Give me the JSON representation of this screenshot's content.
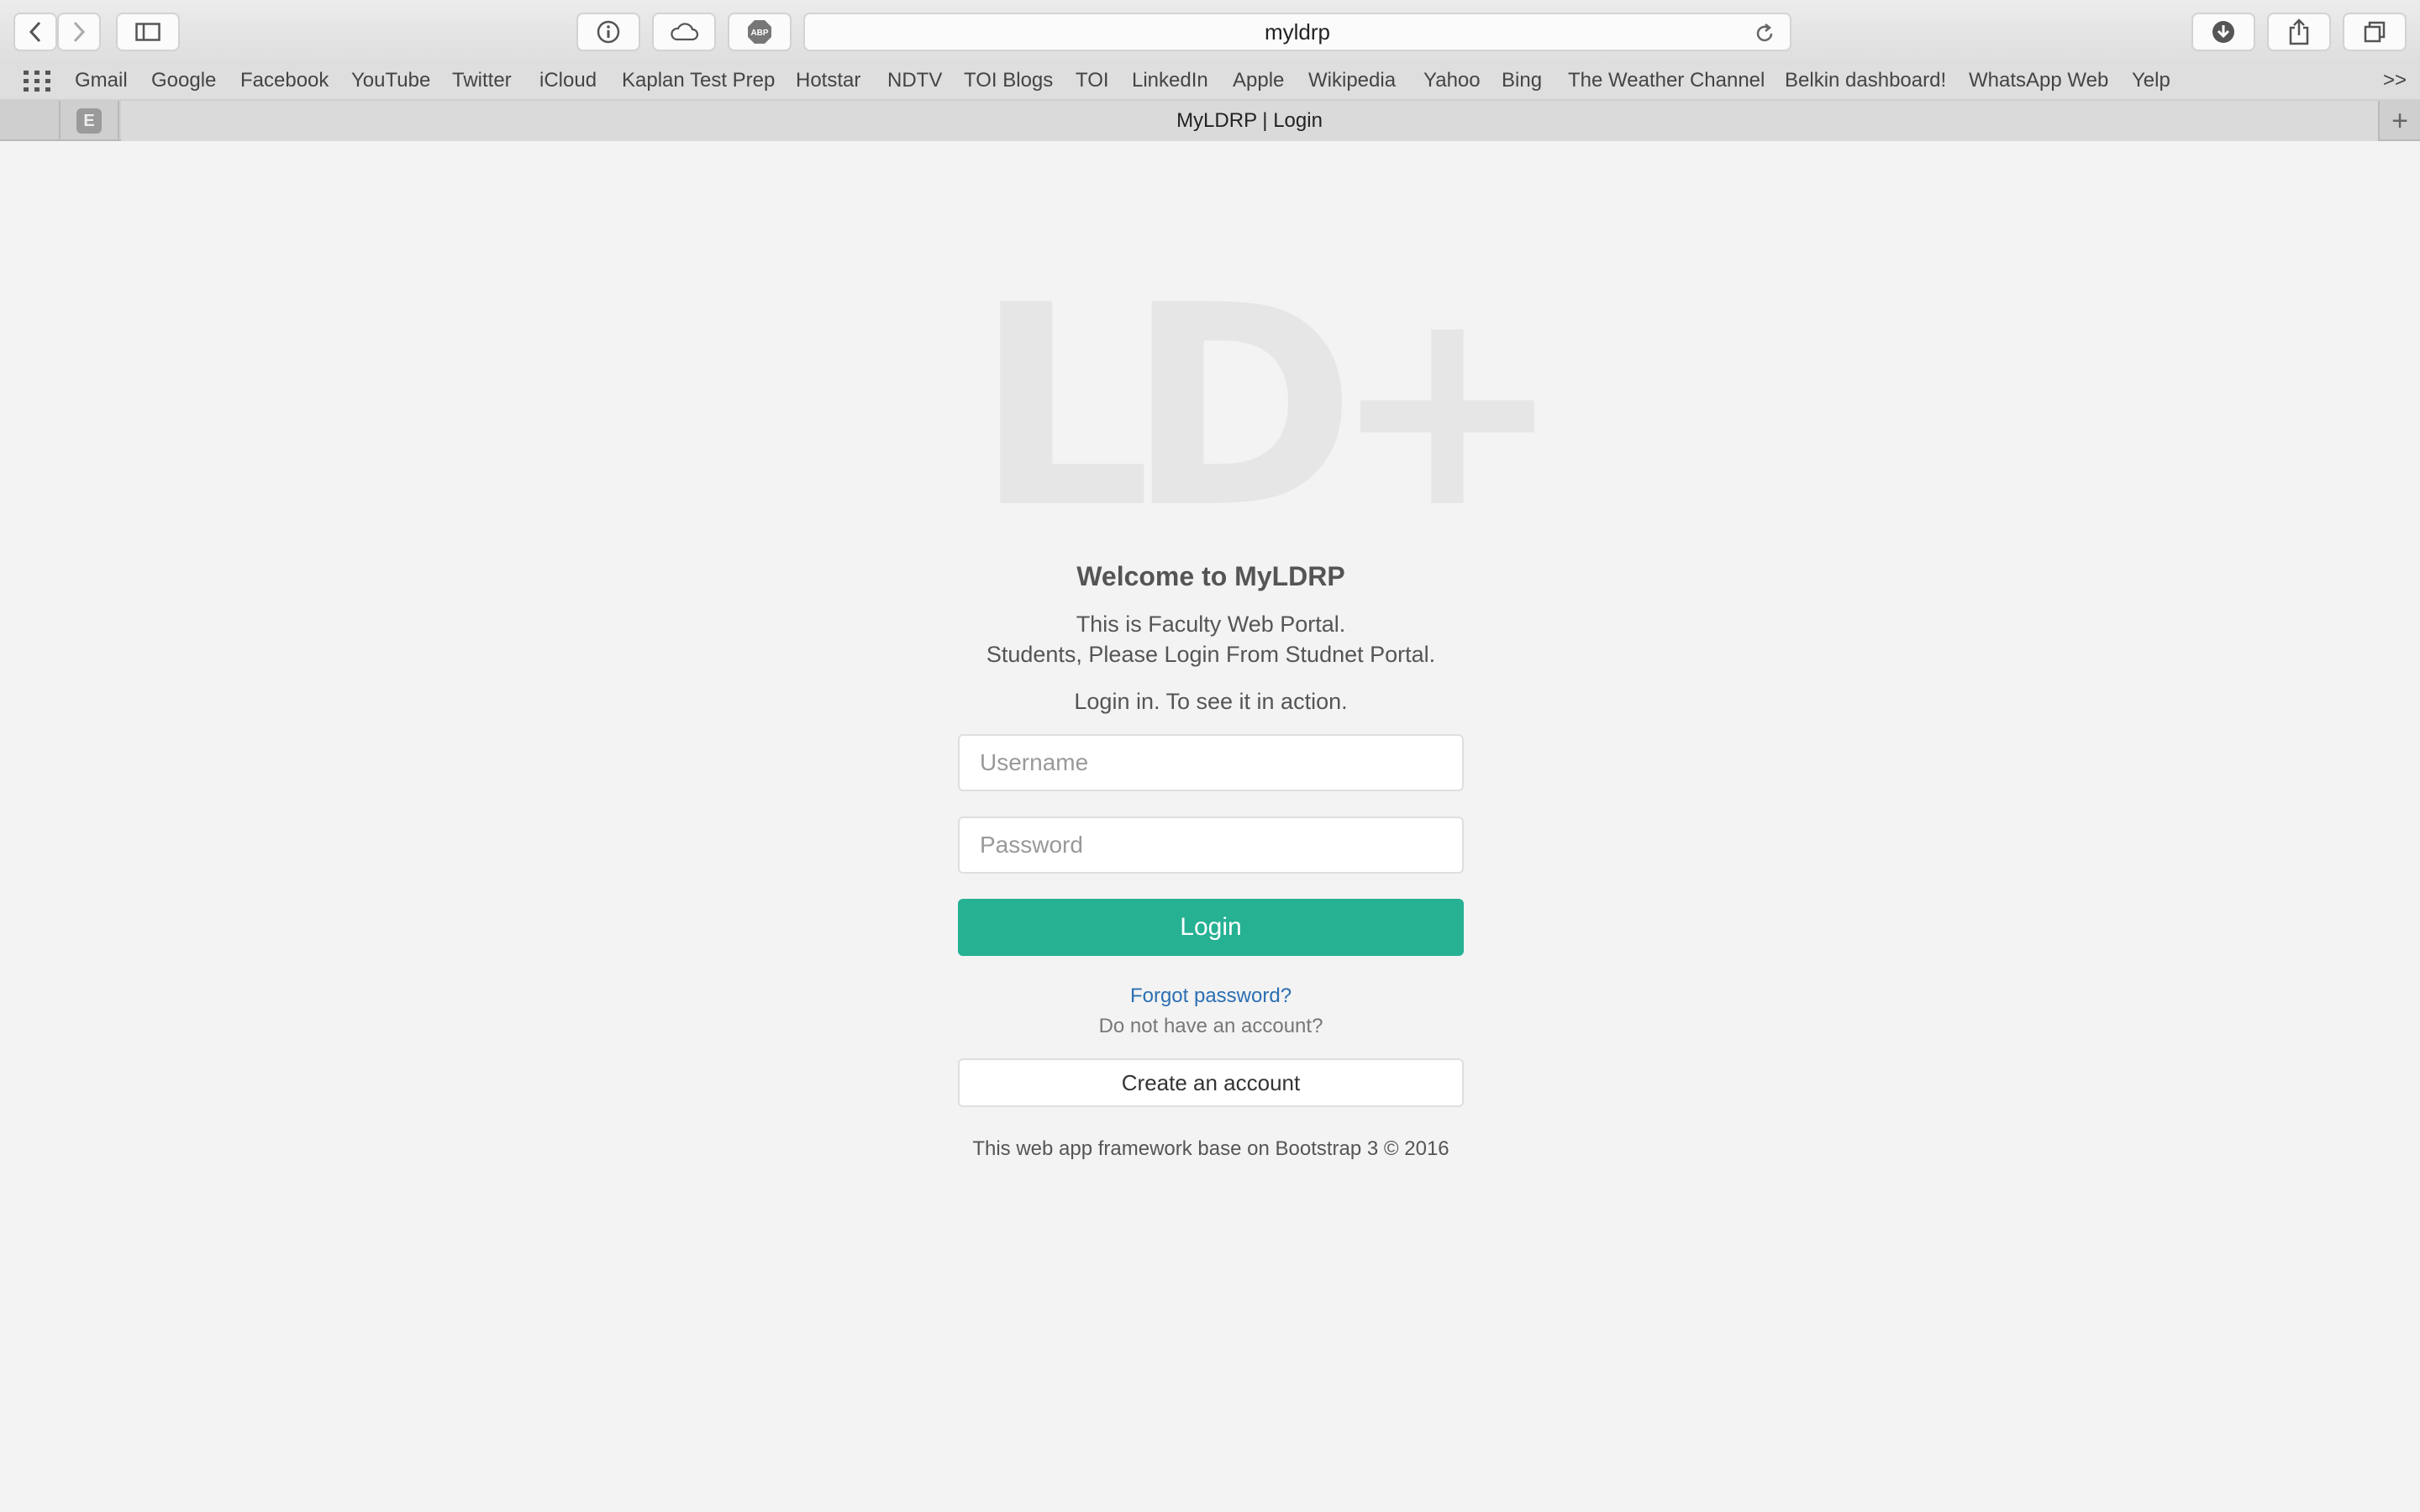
{
  "browser": {
    "url": "myldrp",
    "tab_title": "MyLDRP | Login",
    "pinned_tab_letter": "E",
    "new_tab_symbol": "+",
    "bookmarks_overflow": ">>",
    "bookmarks": [
      "Gmail",
      "Google",
      "Facebook",
      "YouTube",
      "Twitter",
      "iCloud",
      "Kaplan Test Prep",
      "Hotstar",
      "NDTV",
      "TOI Blogs",
      "TOI",
      "LinkedIn",
      "Apple",
      "Wikipedia",
      "Yahoo",
      "Bing",
      "The Weather Channel",
      "Belkin dashboard!",
      "WhatsApp Web",
      "Yelp"
    ],
    "toolbar_icons": [
      "back-icon",
      "forward-icon",
      "sidebar-icon",
      "info-icon",
      "cloud-icon",
      "adblock-icon",
      "reload-icon",
      "download-icon",
      "share-icon",
      "tabs-overview-icon"
    ],
    "adblock_label": "ABP"
  },
  "page": {
    "logo_text": "LD+",
    "welcome": "Welcome to MyLDRP",
    "subtitle_line1": "This is Faculty Web Portal.",
    "subtitle_line2": "Students, Please Login From Studnet Portal.",
    "subtitle_line3": "Login in. To see it in action.",
    "username_placeholder": "Username",
    "password_placeholder": "Password",
    "login_label": "Login",
    "forgot_label": "Forgot password?",
    "no_account_text": "Do not have an account?",
    "create_account_label": "Create an account",
    "footer": "This web app framework base on Bootstrap 3 © 2016"
  },
  "colors": {
    "accent": "#26b193",
    "link": "#2c6fb2",
    "background": "#f3f3f3"
  }
}
